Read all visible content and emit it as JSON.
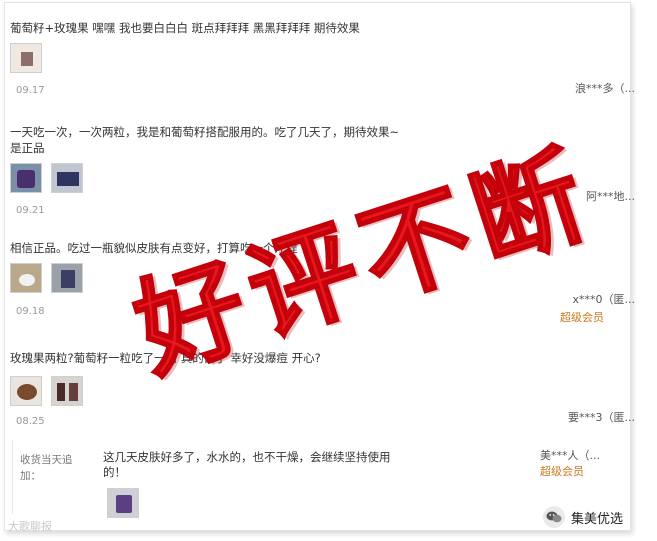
{
  "reviews": [
    {
      "text": "葡萄籽+玫瑰果 嘿嘿 我也要白白白 斑点拜拜拜 黑黑拜拜拜 期待效果",
      "date": "09.17",
      "user": "浪***多（...",
      "vip": ""
    },
    {
      "text": "一天吃一次，一次两粒，我是和葡萄籽搭配服用的。吃了几天了，期待效果~是正品",
      "date": "09.21",
      "user": "阿***地...",
      "vip": ""
    },
    {
      "text": "相信正品。吃过一瓶貌似皮肤有点变好，打算吃一个疗程",
      "date": "09.18",
      "user": "x***0（匿...",
      "vip": "超级会员"
    },
    {
      "text": "玫瑰果两粒?葡萄籽一粒吃了一周 真的白了 幸好没爆痘 开心?",
      "date": "08.25",
      "user": "要***3（匿...",
      "vip": ""
    }
  ],
  "append": {
    "label": "收货当天追加：",
    "text": "这几天皮肤好多了，水水的，也不干燥，会继续坚持使用的！",
    "user": "美***人（...",
    "vip": "超级会员"
  },
  "stamp": "好评不断",
  "watermark": "大歌聊报",
  "brand": "集美优选",
  "colors": {
    "stamp": "#e8161e",
    "vip": "#c9791e"
  }
}
